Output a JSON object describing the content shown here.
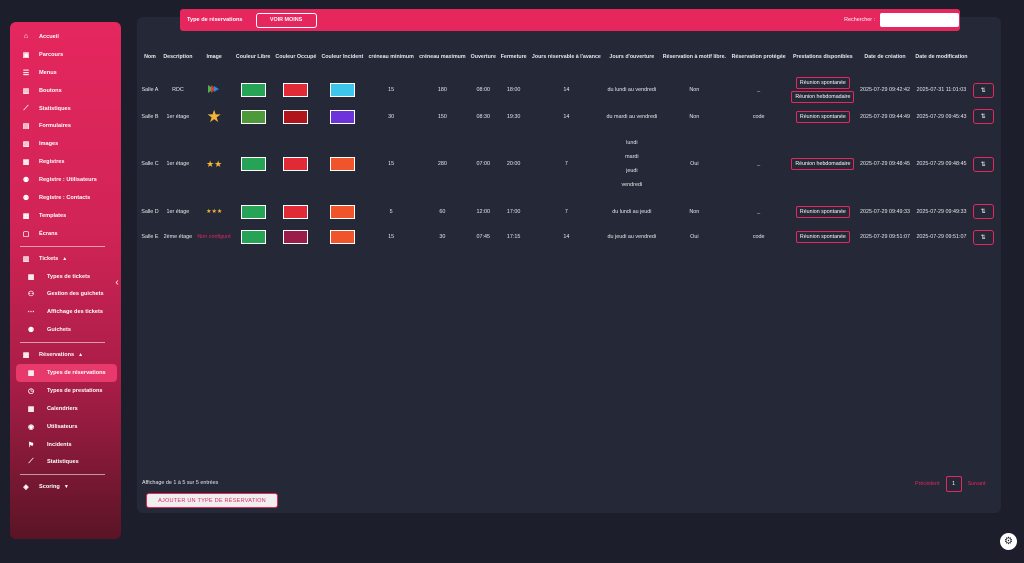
{
  "sidebar": {
    "items": [
      {
        "label": "Accueil",
        "icon": "home-icon",
        "glyph": "⌂"
      },
      {
        "label": "Parcours",
        "icon": "route-icon",
        "glyph": "▣"
      },
      {
        "label": "Menus",
        "icon": "list-icon",
        "glyph": "☰"
      },
      {
        "label": "Boutons",
        "icon": "button-icon",
        "glyph": "▥"
      },
      {
        "label": "Statistiques",
        "icon": "stats-icon",
        "glyph": "⟋"
      },
      {
        "label": "Formulaires",
        "icon": "form-icon",
        "glyph": "▤"
      },
      {
        "label": "Images",
        "icon": "image-icon",
        "glyph": "▨"
      },
      {
        "label": "Registres",
        "icon": "register-icon",
        "glyph": "▦"
      },
      {
        "label": "Registre : Utilisateurs",
        "icon": "users-register-icon",
        "glyph": "⚉"
      },
      {
        "label": "Registre : Contacts",
        "icon": "contacts-register-icon",
        "glyph": "⚉"
      },
      {
        "label": "Templates",
        "icon": "template-icon",
        "glyph": "▩"
      },
      {
        "label": "Écrans",
        "icon": "screen-icon",
        "glyph": "▢"
      }
    ],
    "tickets": {
      "label": "Tickets",
      "caret": "▲",
      "items": [
        {
          "label": "Types de tickets",
          "icon": "ticket-type-icon",
          "glyph": "▦"
        },
        {
          "label": "Gestion des guichets",
          "icon": "counter-management-icon",
          "glyph": "⚇"
        },
        {
          "label": "Affichage des tickets",
          "icon": "ticket-display-icon",
          "glyph": "⋯"
        },
        {
          "label": "Guichets",
          "icon": "counters-icon",
          "glyph": "⚉"
        }
      ]
    },
    "reservations": {
      "label": "Réservations",
      "caret": "▲",
      "items": [
        {
          "label": "Types de réservations",
          "icon": "calendar-icon",
          "glyph": "▦",
          "active": true
        },
        {
          "label": "Types de prestations",
          "icon": "clock-icon",
          "glyph": "◷"
        },
        {
          "label": "Calendriers",
          "icon": "calendars-icon",
          "glyph": "▦"
        },
        {
          "label": "Utilisateurs",
          "icon": "user-circle-icon",
          "glyph": "◉"
        },
        {
          "label": "Incidents",
          "icon": "incident-icon",
          "glyph": "⚑"
        },
        {
          "label": "Statistiques",
          "icon": "stats-icon",
          "glyph": "⟋"
        }
      ]
    },
    "scoring": {
      "label": "Scoring",
      "caret": "▼"
    },
    "collapse_glyph": "‹"
  },
  "toolbar": {
    "title": "Type de réservations",
    "see_less": "VOIR MOINS",
    "search_label": "Rechercher :",
    "search_value": ""
  },
  "table": {
    "headers": [
      "Nom",
      "Description",
      "Image",
      "Couleur Libre",
      "Couleur Occupé",
      "Couleur Incident",
      "créneau minimum",
      "créneau maximum",
      "Ouverture",
      "Fermeture",
      "Jours réservable à l'avance",
      "Jours d'ouverture",
      "Réservation à motif libre.",
      "Réservation protégée",
      "Prestations disponibles",
      "Date de création",
      "Date de modification",
      ""
    ],
    "rows": [
      {
        "nom": "Salle A",
        "description": "RDC",
        "image": "play-logo",
        "libre": "#27a356",
        "occupe": "#e02a35",
        "incident": "#3ec6ea",
        "min": "15",
        "max": "180",
        "ouverture": "08:00",
        "fermeture": "18:00",
        "avance": "14",
        "jours": [
          "du lundi au vendredi"
        ],
        "motif": "Non",
        "protegee": "_",
        "prestations": [
          "Réunion spontanée",
          "Réunion hebdomadaire"
        ],
        "creation": "2025-07-29 09:42:42",
        "modification": "2025-07-31 11:01:03"
      },
      {
        "nom": "Salle B",
        "description": "1er étage",
        "image": "star-large",
        "libre": "#4e9a3b",
        "occupe": "#b0151b",
        "incident": "#6b33d8",
        "min": "30",
        "max": "150",
        "ouverture": "08:30",
        "fermeture": "19:30",
        "avance": "14",
        "jours": [
          "du mardi au vendredi"
        ],
        "motif": "Non",
        "protegee": "code",
        "prestations": [
          "Réunion spontanée"
        ],
        "creation": "2025-07-29 09:44:49",
        "modification": "2025-07-29 09:45:43"
      },
      {
        "nom": "Salle C",
        "description": "1er étage",
        "image": "two-stars",
        "libre": "#27a356",
        "occupe": "#e02a35",
        "incident": "#f0542b",
        "min": "15",
        "max": "280",
        "ouverture": "07:00",
        "fermeture": "20:00",
        "avance": "7",
        "jours": [
          "lundi",
          "mardi",
          "jeudi",
          "vendredi"
        ],
        "motif": "Oui",
        "protegee": "_",
        "prestations": [
          "Réunion hebdomadaire"
        ],
        "creation": "2025-07-29 09:48:45",
        "modification": "2025-07-29 09:48:45"
      },
      {
        "nom": "Salle D",
        "description": "1er étage",
        "image": "three-stars",
        "libre": "#27a356",
        "occupe": "#e02a35",
        "incident": "#f0542b",
        "min": "5",
        "max": "60",
        "ouverture": "12:00",
        "fermeture": "17:00",
        "avance": "7",
        "jours": [
          "du lundi au jeudi"
        ],
        "motif": "Non",
        "protegee": "_",
        "prestations": [
          "Réunion spontanée"
        ],
        "creation": "2025-07-29 09:49:33",
        "modification": "2025-07-29 09:49:33"
      },
      {
        "nom": "Salle E",
        "description": "2ème étage",
        "image": "none",
        "image_text": "Non configuré",
        "libre": "#27a356",
        "occupe": "#9a1c49",
        "incident": "#f0542b",
        "min": "15",
        "max": "30",
        "ouverture": "07:45",
        "fermeture": "17:15",
        "avance": "14",
        "jours": [
          "du jeudi au vendredi"
        ],
        "motif": "Oui",
        "protegee": "code",
        "prestations": [
          "Réunion spontanée"
        ],
        "creation": "2025-07-29 09:51:07",
        "modification": "2025-07-29 09:51:07"
      }
    ],
    "action_glyph": "⇅"
  },
  "footer": {
    "info": "Affichage de 1 à 5 sur 5 entrées",
    "add_button": "AJOUTER UN TYPE DE RÉSERVATION",
    "prev": "Précédent",
    "page": "1",
    "next": "Suivant"
  },
  "settings_glyph": "⚙",
  "colors": {
    "accent": "#e5275e",
    "background": "#1c1f2b",
    "card": "#242837"
  }
}
